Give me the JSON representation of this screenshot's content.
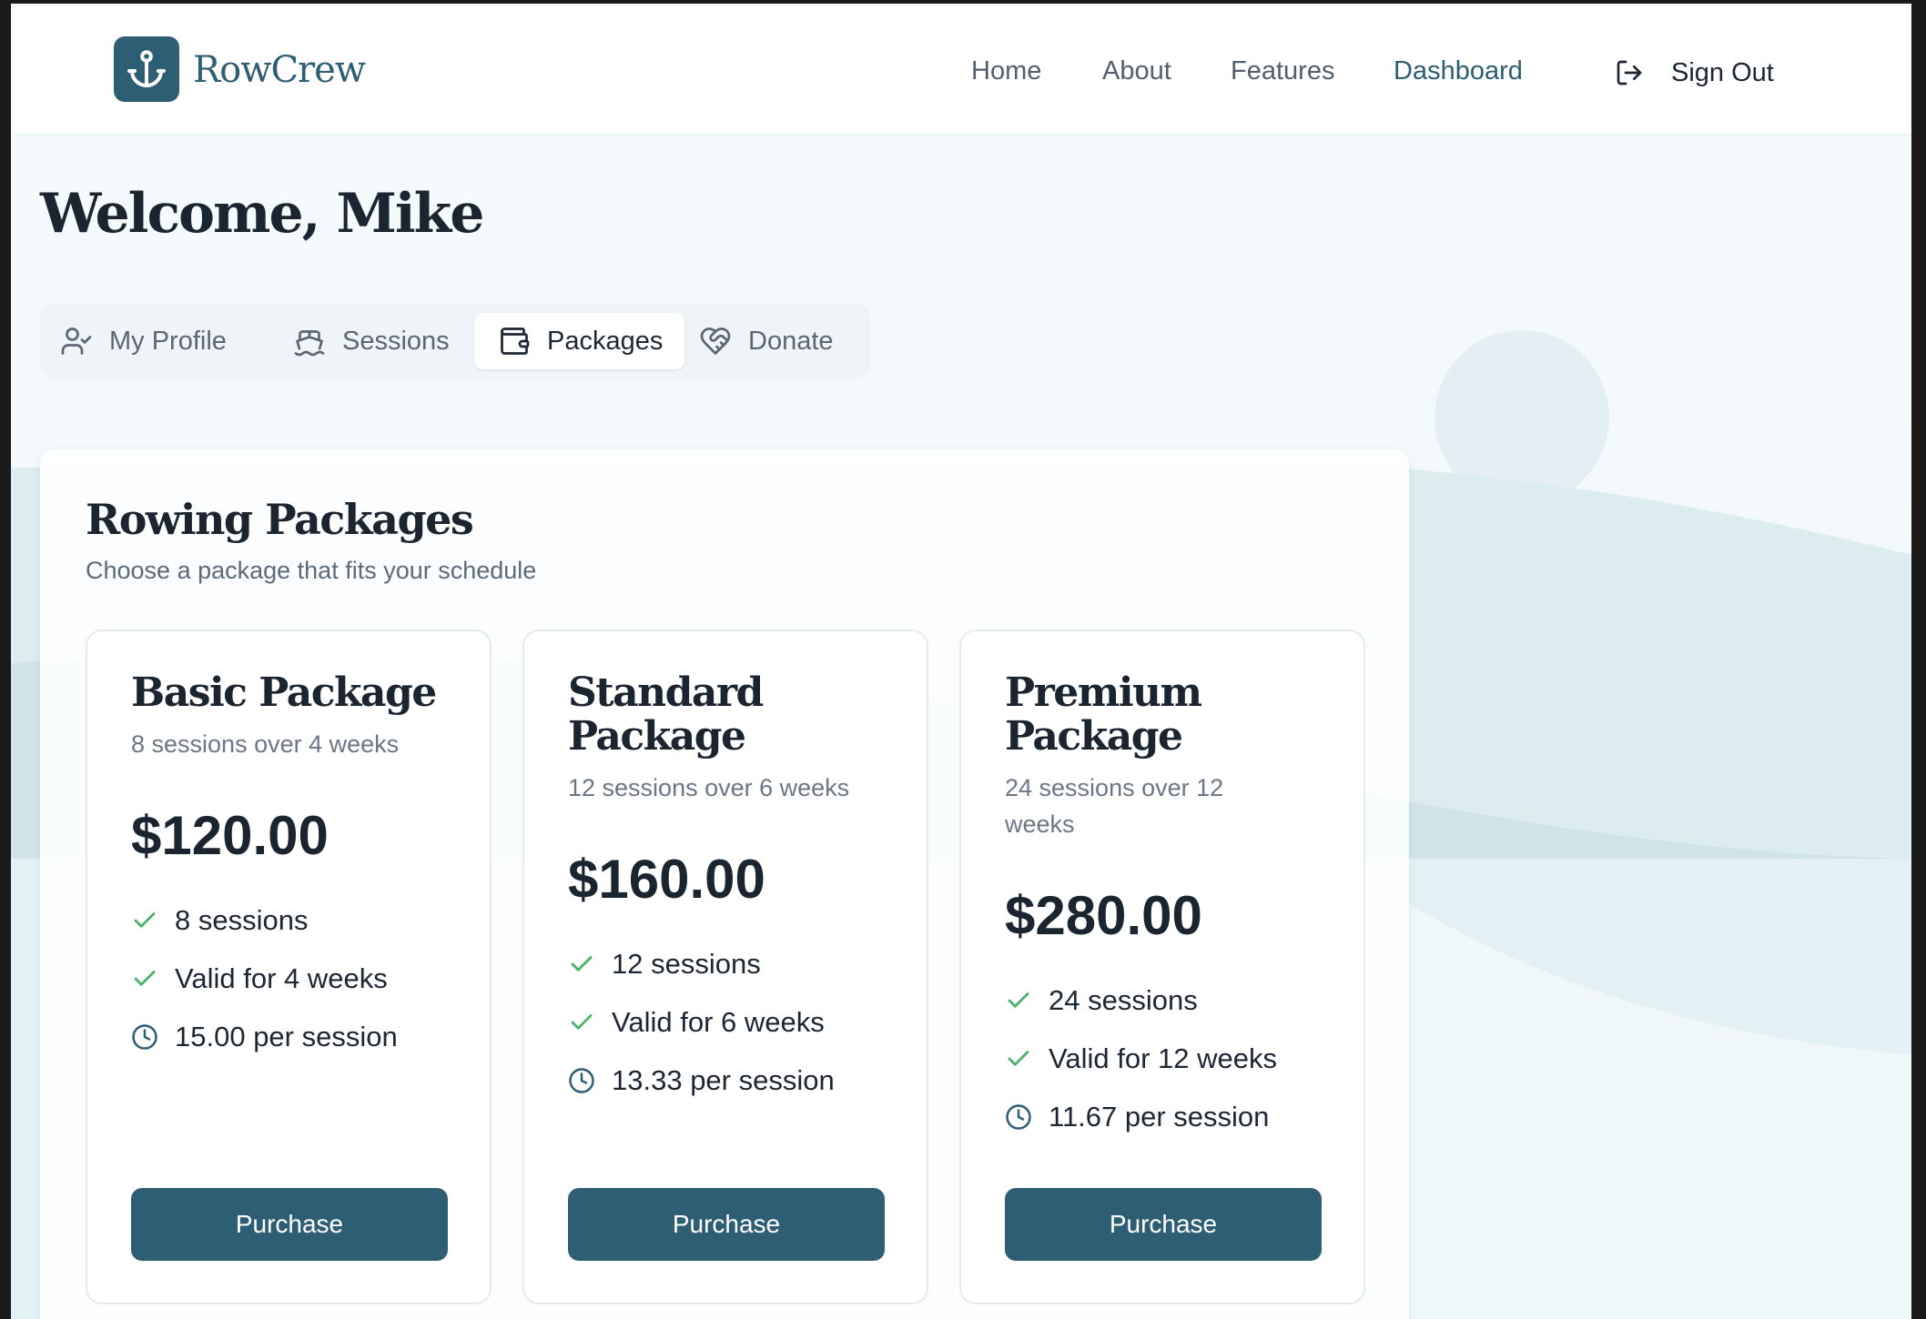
{
  "brand": {
    "name": "RowCrew",
    "logo_icon": "anchor-icon",
    "primary_color": "#2e5e74"
  },
  "nav": {
    "items": [
      {
        "label": "Home"
      },
      {
        "label": "About"
      },
      {
        "label": "Features"
      },
      {
        "label": "Dashboard",
        "active": true
      }
    ],
    "signout_label": "Sign Out",
    "signout_icon": "sign-out-icon"
  },
  "welcome": "Welcome, Mike",
  "tabs": [
    {
      "label": "My Profile",
      "icon": "user-check-icon"
    },
    {
      "label": "Sessions",
      "icon": "boat-icon"
    },
    {
      "label": "Packages",
      "icon": "wallet-icon",
      "active": true
    },
    {
      "label": "Donate",
      "icon": "heart-handshake-icon"
    }
  ],
  "packages": {
    "title": "Rowing Packages",
    "subtitle": "Choose a package that fits your schedule",
    "cards": [
      {
        "name": "Basic Package",
        "description": "8 sessions over 4 weeks",
        "price": "$120.00",
        "features": [
          "8 sessions",
          "Valid for 4 weeks",
          "15.00 per session"
        ],
        "button": "Purchase"
      },
      {
        "name": "Standard Package",
        "description": "12 sessions over 6 weeks",
        "price": "$160.00",
        "features": [
          "12 sessions",
          "Valid for 6 weeks",
          "13.33 per session"
        ],
        "button": "Purchase"
      },
      {
        "name": "Premium Package",
        "description": "24 sessions over 12 weeks",
        "price": "$280.00",
        "features": [
          "24 sessions",
          "Valid for 12 weeks",
          "11.67 per session"
        ],
        "button": "Purchase"
      }
    ],
    "check_color": "#4caf6a"
  }
}
